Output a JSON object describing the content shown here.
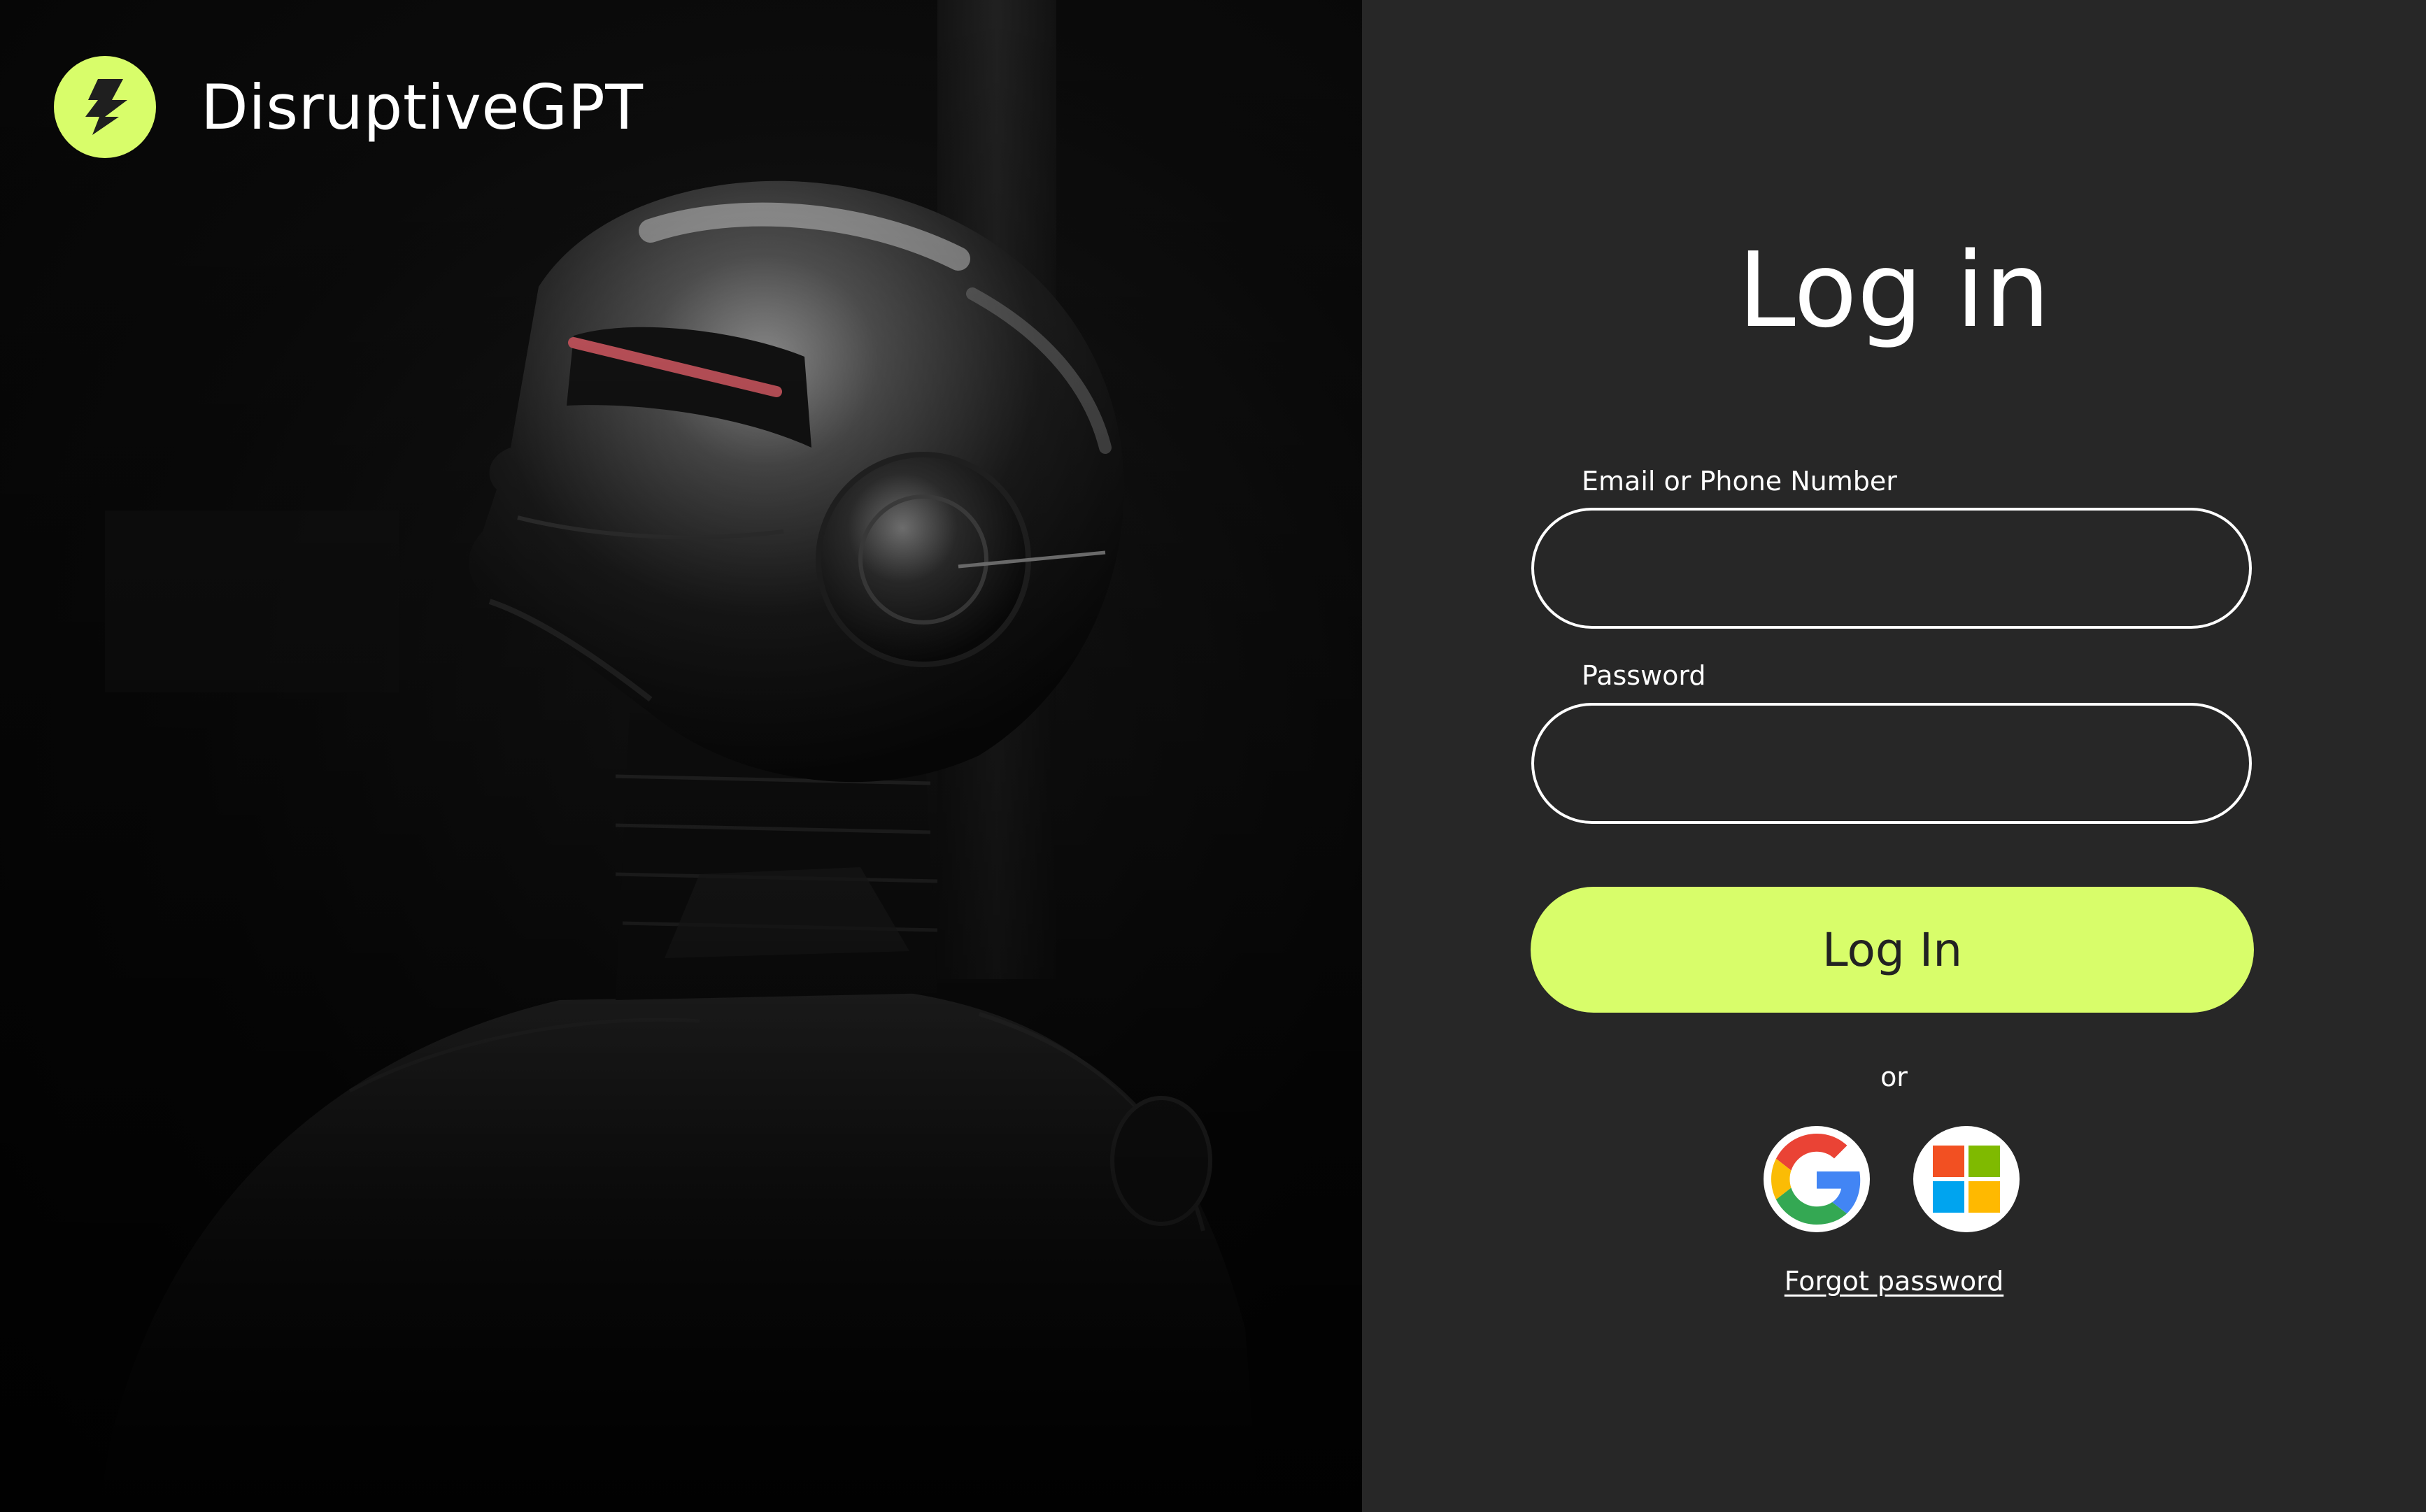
{
  "brand": {
    "name": "DisruptiveGPT",
    "logo_icon": "lightning-bolt-icon",
    "accent_color": "#d8fd6a"
  },
  "hero": {
    "image_subject": "chrome-robot-head-illustration"
  },
  "login": {
    "title": "Log in",
    "email_label": "Email or Phone Number",
    "email_value": "",
    "password_label": "Password",
    "password_value": "",
    "submit_label": "Log In",
    "divider_text": "or",
    "social_providers": [
      {
        "name": "Google",
        "icon": "google-icon"
      },
      {
        "name": "Microsoft",
        "icon": "microsoft-icon"
      }
    ],
    "forgot_password_label": "Forgot password"
  },
  "colors": {
    "panel_background": "#272727",
    "button_background": "#d8fd6a",
    "button_text": "#222222",
    "text": "#ffffff"
  }
}
